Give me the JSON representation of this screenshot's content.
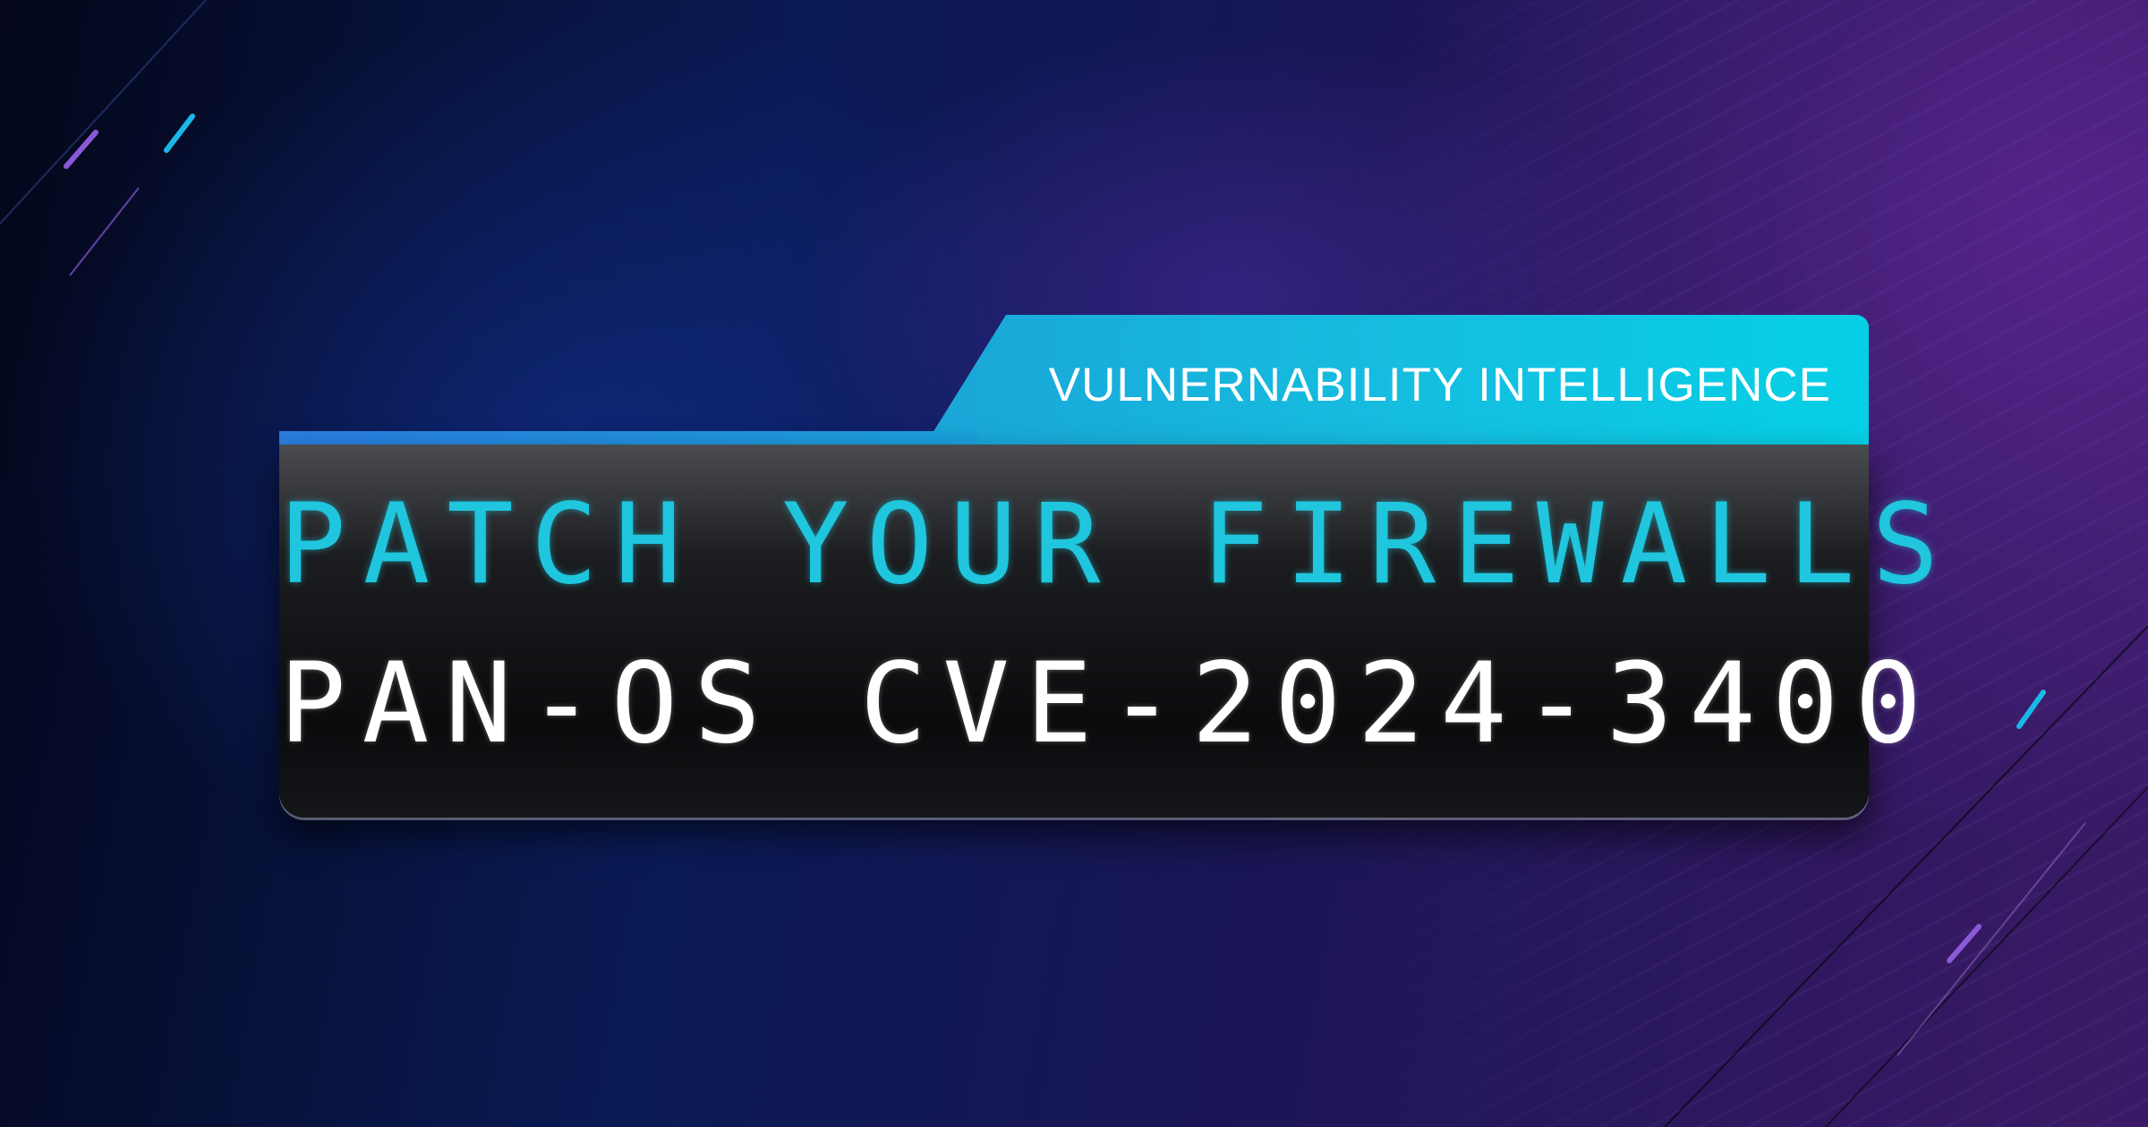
{
  "banner": {
    "category_label": "VULNERNABILITY INTELLIGENCE",
    "headline": "PATCH YOUR FIREWALLS",
    "cve_id": "PAN-OS CVE-2024-3400"
  },
  "colors": {
    "accent_cyan": "#1fc6dd",
    "tab_gradient_start": "#1aa6d8",
    "tab_gradient_end": "#06d0e6",
    "stripe_blue": "#2a7de0",
    "background_dark": "#07091c",
    "background_purple": "#3a1a66"
  }
}
